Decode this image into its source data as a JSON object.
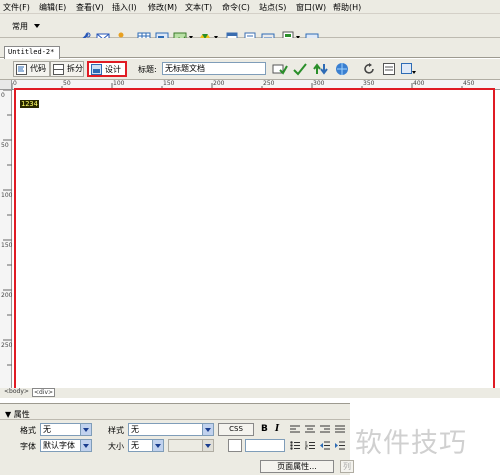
{
  "menubar": {
    "items": [
      "文件(F)",
      "编辑(E)",
      "查看(V)",
      "插入(I)",
      "修改(M)",
      "文本(T)",
      "命令(C)",
      "站点(S)",
      "窗口(W)",
      "帮助(H)"
    ]
  },
  "insert_bar": {
    "category": "常用"
  },
  "document": {
    "tab_label": "Untitled-2*",
    "view_code": "代码",
    "view_split": "拆分",
    "view_design": "设计",
    "title_label": "标题:",
    "title_value": "无标题文档",
    "content_text": "1234"
  },
  "ruler": {
    "h_ticks": [
      "0",
      "50",
      "100",
      "150",
      "200",
      "250",
      "300",
      "350",
      "400",
      "450"
    ],
    "v_ticks": [
      "0",
      "50",
      "100",
      "150",
      "200",
      "250"
    ]
  },
  "statusbar": {
    "tag_body": "<body>",
    "tag_div": "<div>"
  },
  "properties": {
    "panel_title": "▼ 属性",
    "format_label": "格式",
    "format_value": "无",
    "style_label": "样式",
    "style_value": "无",
    "css_button": "CSS",
    "bold": "B",
    "italic": "I",
    "font_label": "字体",
    "font_value": "默认字体",
    "size_label": "大小",
    "size_value": "无",
    "page_props_button": "页面属性...",
    "list_item_button": "列"
  },
  "watermark": "软件技巧",
  "colors": {
    "highlight": "#e01b24",
    "chrome": "#ecebe3",
    "selection_bg": "#2a2a00",
    "selection_fg": "#ffff66"
  }
}
